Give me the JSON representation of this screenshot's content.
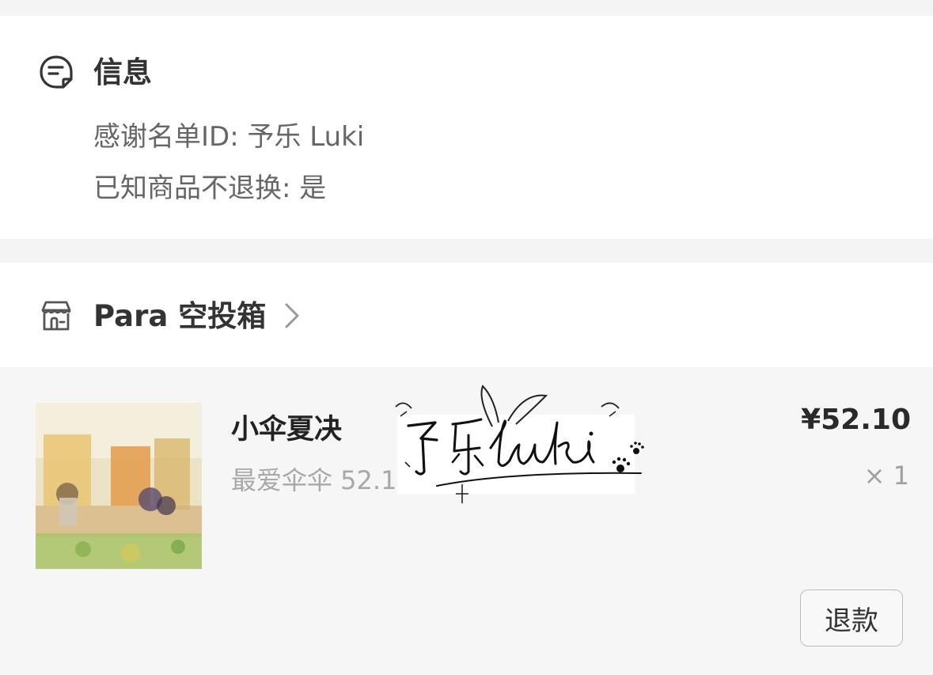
{
  "info": {
    "title": "信息",
    "thanks_list": "感谢名单ID: 予乐 Luki",
    "no_return_ack": "已知商品不退换: 是",
    "icon": "message-note-icon"
  },
  "store": {
    "name": "Para 空投箱",
    "icon": "shop-icon",
    "chevron_icon": "chevron-right-icon"
  },
  "item": {
    "name": "小伞夏决",
    "spec": "最爱伞伞 52.1",
    "price": "¥52.10",
    "quantity": "× 1",
    "refund_label": "退款",
    "watermark_text": "予乐luki"
  },
  "colors": {
    "card_bg": "#ffffff",
    "page_bg": "#f4f4f4",
    "item_bg": "#f6f6f6",
    "title_text": "#333333",
    "secondary_text": "#666666",
    "muted_text": "#a8a8a8"
  }
}
